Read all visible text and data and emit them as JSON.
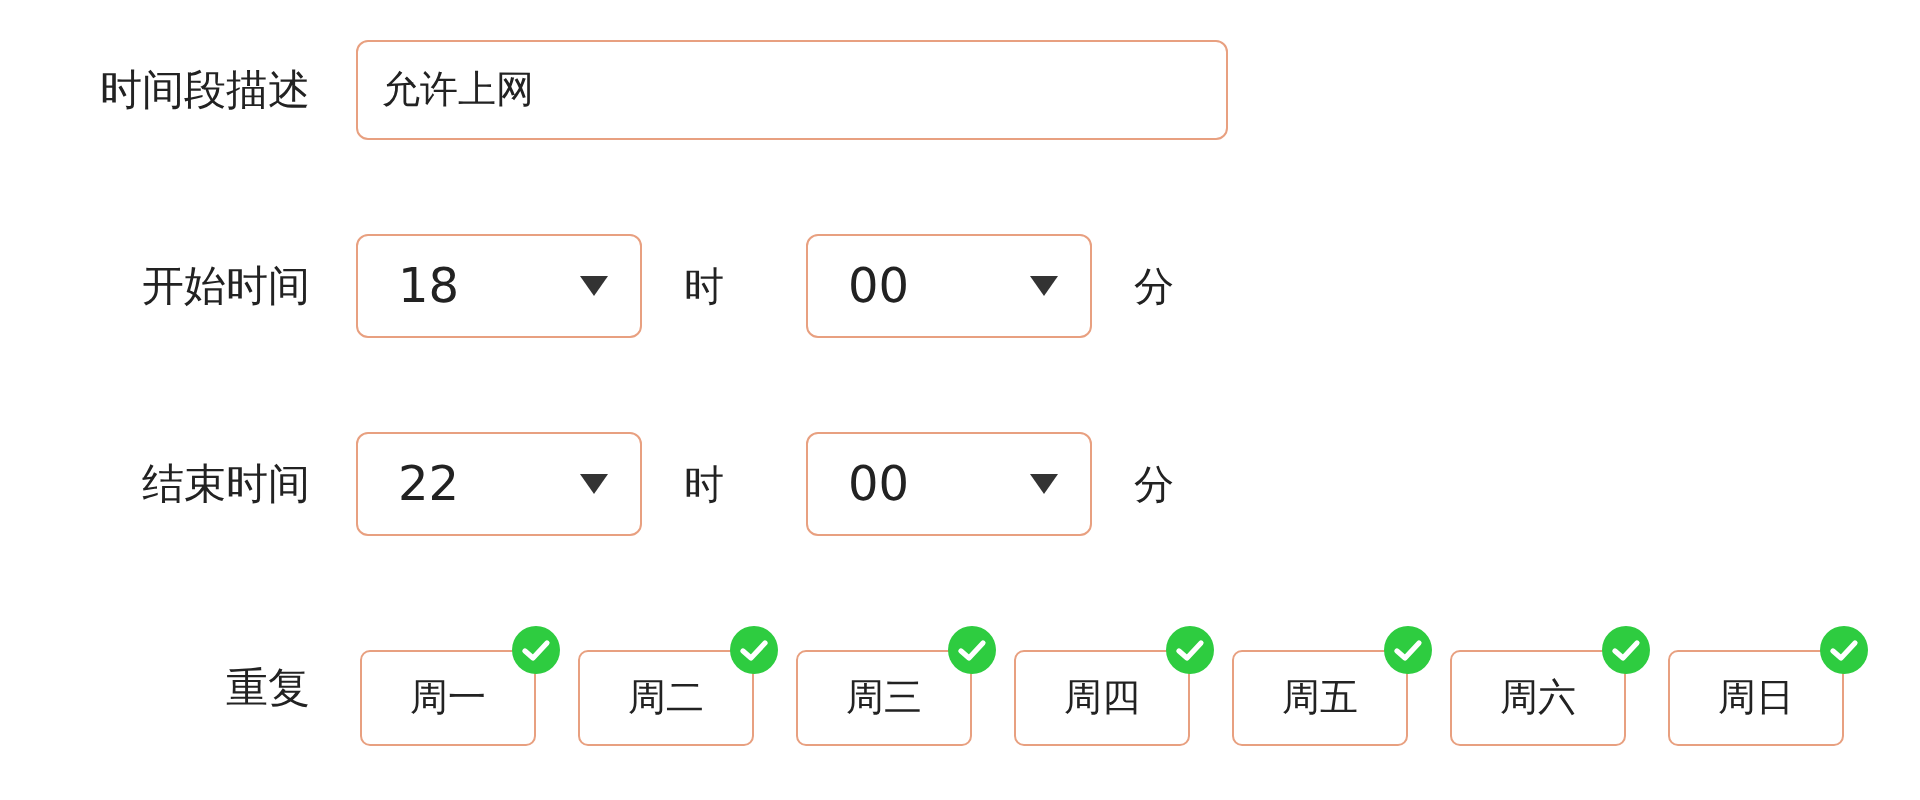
{
  "description": {
    "label": "时间段描述",
    "value": "允许上网"
  },
  "times": [
    {
      "label": "开始时间",
      "hour": "18",
      "hour_unit": "时",
      "minute": "00",
      "minute_unit": "分"
    },
    {
      "label": "结束时间",
      "hour": "22",
      "hour_unit": "时",
      "minute": "00",
      "minute_unit": "分"
    }
  ],
  "repeat": {
    "label": "重复",
    "days": [
      {
        "label": "周一",
        "checked": true
      },
      {
        "label": "周二",
        "checked": true
      },
      {
        "label": "周三",
        "checked": true
      },
      {
        "label": "周四",
        "checked": true
      },
      {
        "label": "周五",
        "checked": true
      },
      {
        "label": "周六",
        "checked": true
      },
      {
        "label": "周日",
        "checked": true
      }
    ]
  }
}
